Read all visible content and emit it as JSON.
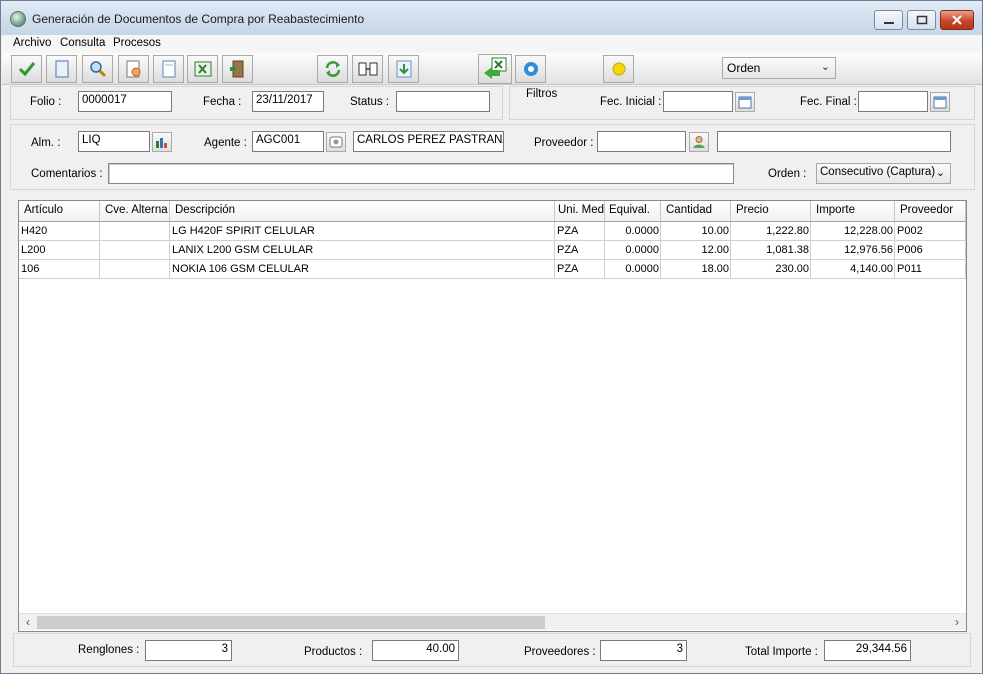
{
  "window": {
    "title": "Generación de Documentos de Compra por Reabastecimiento"
  },
  "menu": [
    "Archivo",
    "Consulta",
    "Procesos"
  ],
  "toolbar": {
    "buttons": [
      "check-icon",
      "document-icon",
      "search-icon",
      "document-search-icon",
      "blank-page-icon",
      "excel-icon",
      "exit-door-icon",
      "refresh-icon",
      "transfer-icon",
      "download-icon",
      "excel-export-icon",
      "gear-icon",
      "yellow-dot-icon"
    ],
    "orden_value": "Orden"
  },
  "header": {
    "folio_label": "Folio :",
    "folio_value": "0000017",
    "fecha_label": "Fecha :",
    "fecha_value": "23/11/2017",
    "status_label": "Status :",
    "status_value": "",
    "filtros_label": "Filtros",
    "fec_inicial_label": "Fec. Inicial :",
    "fec_inicial_value": "",
    "fec_final_label": "Fec. Final :",
    "fec_final_value": ""
  },
  "filters": {
    "alm_label": "Alm. :",
    "alm_value": "LIQ",
    "agente_label": "Agente :",
    "agente_code": "AGC001",
    "agente_name": "CARLOS PEREZ PASTRANA",
    "proveedor_label": "Proveedor :",
    "proveedor_code": "",
    "proveedor_name": "",
    "comentarios_label": "Comentarios :",
    "comentarios_value": "",
    "orden_label": "Orden :",
    "orden_value": "Consecutivo (Captura)"
  },
  "grid": {
    "columns": [
      "Artículo",
      "Cve. Alterna",
      "Descripción",
      "Uni. Med.",
      "Equival.",
      "Cantidad",
      "Precio",
      "Importe",
      "Proveedor"
    ],
    "rows": [
      [
        "H420",
        "",
        "LG H420F SPIRIT CELULAR",
        "PZA",
        "0.0000",
        "10.00",
        "1,222.80",
        "12,228.00",
        "P002"
      ],
      [
        "L200",
        "",
        "LANIX L200 GSM CELULAR",
        "PZA",
        "0.0000",
        "12.00",
        "1,081.38",
        "12,976.56",
        "P006"
      ],
      [
        "106",
        "",
        "NOKIA 106 GSM CELULAR",
        "PZA",
        "0.0000",
        "18.00",
        "230.00",
        "4,140.00",
        "P011"
      ]
    ]
  },
  "footer": {
    "renglones_label": "Renglones :",
    "renglones_value": "3",
    "productos_label": "Productos :",
    "productos_value": "40.00",
    "proveedores_label": "Proveedores :",
    "proveedores_value": "3",
    "total_label": "Total Importe :",
    "total_value": "29,344.56"
  },
  "colors": {
    "accent_green": "#2e9a2e",
    "grid_border": "#828790",
    "close_red": "#c7462c"
  }
}
